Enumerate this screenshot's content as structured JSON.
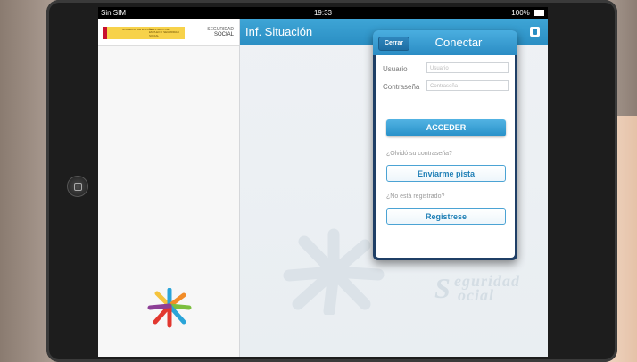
{
  "status_bar": {
    "carrier": "Sin SIM",
    "time": "19:33",
    "battery": "100%"
  },
  "gov_header": {
    "gov_text": "GOBIERNO DE ESPAÑA",
    "ministry_text": "MINISTERIO DE EMPLEO Y SEGURIDAD SOCIAL",
    "brand_line1": "SEGURIDAD",
    "brand_line2": "SOCIAL"
  },
  "nav": {
    "title": "Inf. Situación"
  },
  "login_popover": {
    "close_label": "Cerrar",
    "title": "Conectar",
    "user_label": "Usuario",
    "user_placeholder": "Usuario",
    "password_label": "Contraseña",
    "password_placeholder": "Contraseña",
    "submit_label": "ACCEDER",
    "forgot_question": "¿Olvidó su contraseña?",
    "hint_button_label": "Enviarme pista",
    "register_question": "¿No está registrado?",
    "register_button_label": "Registrese"
  },
  "watermark": {
    "line1": "eguridad",
    "line2": "ocial",
    "initial": "S"
  },
  "colors": {
    "nav_blue": "#2a8ec3",
    "popover_border": "#1f3f66",
    "accent": "#4aaee0"
  }
}
